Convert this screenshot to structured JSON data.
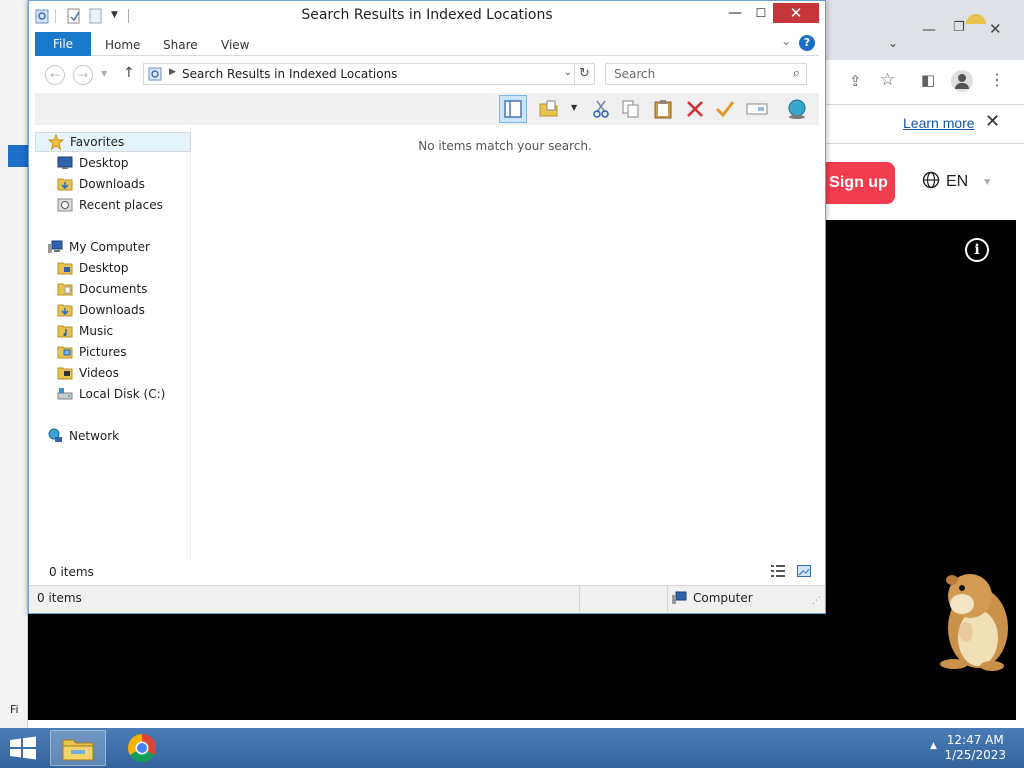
{
  "explorer": {
    "title": "Search Results in Indexed Locations",
    "ribbon": {
      "file": "File",
      "tabs": [
        "Home",
        "Share",
        "View"
      ]
    },
    "address": {
      "path": "Search Results in Indexed Locations"
    },
    "search": {
      "placeholder": "Search"
    },
    "nav": {
      "favorites": "Favorites",
      "fav_items": [
        "Desktop",
        "Downloads",
        "Recent places"
      ],
      "computer": "My Computer",
      "comp_items": [
        "Desktop",
        "Documents",
        "Downloads",
        "Music",
        "Pictures",
        "Videos",
        "Local Disk (C:)"
      ],
      "network": "Network"
    },
    "empty_message": "No items match your search.",
    "status": {
      "items": "0 items",
      "bottom_items": "0 items",
      "location": "Computer"
    }
  },
  "browser": {
    "learn_more": "Learn more",
    "signup": "Sign up",
    "language": "EN"
  },
  "taskbar": {
    "time": "12:47 AM",
    "date": "1/25/2023"
  },
  "colors": {
    "file_tab": "#1979ca",
    "signup": "#f23d4f",
    "taskbar": "#3d6fa8",
    "close": "#c7363a"
  },
  "left_strip": {
    "text": "Fi"
  }
}
